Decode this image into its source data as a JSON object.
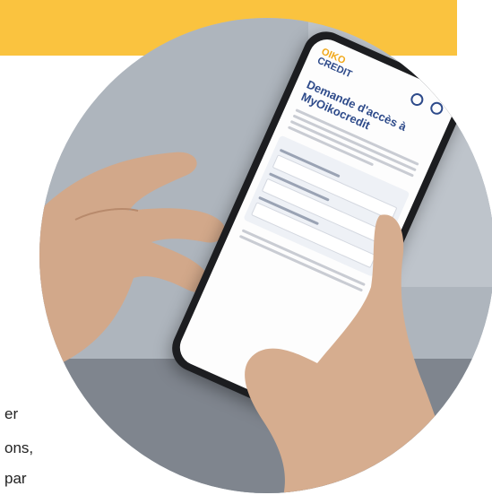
{
  "banner": {
    "color": "#FAC33F"
  },
  "phone_screen": {
    "logo_line1": "OIKO",
    "logo_line2": "CREDIT",
    "title": "Demande d'accès à MyOikocredit"
  },
  "text_fragments": {
    "line1": "er",
    "line2": "ons,",
    "line3": "par"
  }
}
